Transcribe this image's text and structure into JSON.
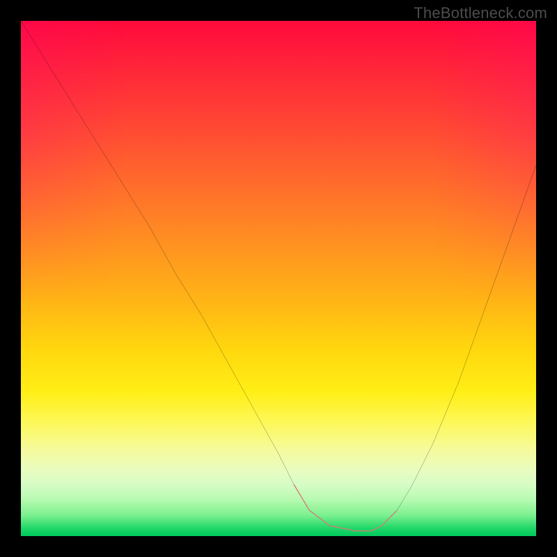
{
  "watermark": "TheBottleneck.com",
  "chart_data": {
    "type": "line",
    "title": "",
    "xlabel": "",
    "ylabel": "",
    "xlim": [
      0,
      100
    ],
    "ylim": [
      0,
      100
    ],
    "grid": false,
    "legend": false,
    "series": [
      {
        "name": "bottleneck-curve",
        "x": [
          0,
          5,
          10,
          15,
          20,
          25,
          30,
          35,
          40,
          45,
          50,
          53,
          56,
          60,
          65,
          68,
          70,
          73,
          76,
          80,
          85,
          90,
          95,
          100
        ],
        "y": [
          100,
          92,
          84,
          76,
          68,
          60,
          51,
          43,
          34,
          25,
          16,
          10,
          5,
          2,
          1,
          1,
          2,
          5,
          10,
          18,
          30,
          44,
          58,
          72
        ]
      }
    ],
    "annotations": [
      {
        "name": "flat-bottom-highlight",
        "kind": "polyline",
        "color": "#d47b78",
        "x": [
          53,
          56,
          60,
          65,
          68,
          70,
          73
        ],
        "y": [
          10,
          5,
          2,
          1,
          1,
          2,
          5
        ]
      }
    ],
    "background": {
      "kind": "vertical-gradient",
      "stops": [
        {
          "pos": 0.0,
          "hex": "#ff0a3c"
        },
        {
          "pos": 0.36,
          "hex": "#ff7a28"
        },
        {
          "pos": 0.64,
          "hex": "#ffd80e"
        },
        {
          "pos": 0.87,
          "hex": "#eafcbe"
        },
        {
          "pos": 1.0,
          "hex": "#00c95c"
        }
      ]
    }
  }
}
